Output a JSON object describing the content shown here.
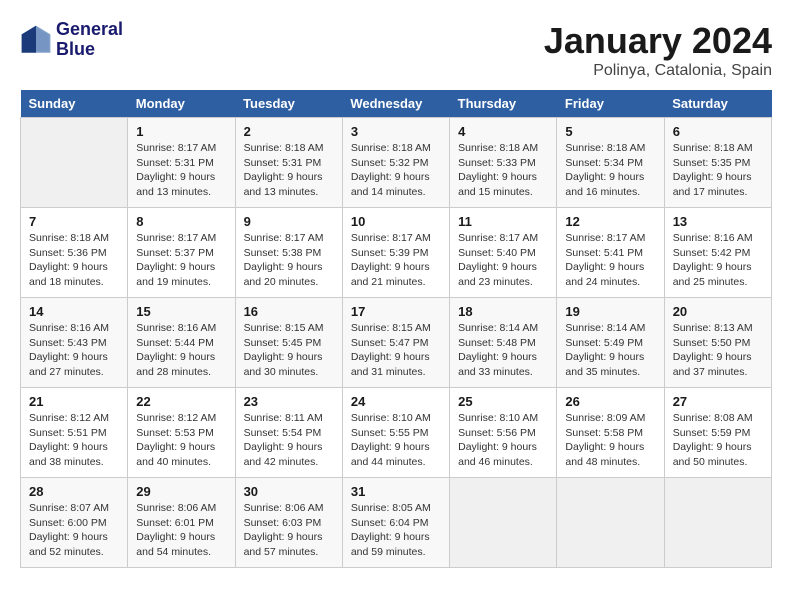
{
  "header": {
    "logo_line1": "General",
    "logo_line2": "Blue",
    "month": "January 2024",
    "location": "Polinya, Catalonia, Spain"
  },
  "weekdays": [
    "Sunday",
    "Monday",
    "Tuesday",
    "Wednesday",
    "Thursday",
    "Friday",
    "Saturday"
  ],
  "weeks": [
    [
      {
        "day": "",
        "sunrise": "",
        "sunset": "",
        "daylight": ""
      },
      {
        "day": "1",
        "sunrise": "Sunrise: 8:17 AM",
        "sunset": "Sunset: 5:31 PM",
        "daylight": "Daylight: 9 hours and 13 minutes."
      },
      {
        "day": "2",
        "sunrise": "Sunrise: 8:18 AM",
        "sunset": "Sunset: 5:31 PM",
        "daylight": "Daylight: 9 hours and 13 minutes."
      },
      {
        "day": "3",
        "sunrise": "Sunrise: 8:18 AM",
        "sunset": "Sunset: 5:32 PM",
        "daylight": "Daylight: 9 hours and 14 minutes."
      },
      {
        "day": "4",
        "sunrise": "Sunrise: 8:18 AM",
        "sunset": "Sunset: 5:33 PM",
        "daylight": "Daylight: 9 hours and 15 minutes."
      },
      {
        "day": "5",
        "sunrise": "Sunrise: 8:18 AM",
        "sunset": "Sunset: 5:34 PM",
        "daylight": "Daylight: 9 hours and 16 minutes."
      },
      {
        "day": "6",
        "sunrise": "Sunrise: 8:18 AM",
        "sunset": "Sunset: 5:35 PM",
        "daylight": "Daylight: 9 hours and 17 minutes."
      }
    ],
    [
      {
        "day": "7",
        "sunrise": "Sunrise: 8:18 AM",
        "sunset": "Sunset: 5:36 PM",
        "daylight": "Daylight: 9 hours and 18 minutes."
      },
      {
        "day": "8",
        "sunrise": "Sunrise: 8:17 AM",
        "sunset": "Sunset: 5:37 PM",
        "daylight": "Daylight: 9 hours and 19 minutes."
      },
      {
        "day": "9",
        "sunrise": "Sunrise: 8:17 AM",
        "sunset": "Sunset: 5:38 PM",
        "daylight": "Daylight: 9 hours and 20 minutes."
      },
      {
        "day": "10",
        "sunrise": "Sunrise: 8:17 AM",
        "sunset": "Sunset: 5:39 PM",
        "daylight": "Daylight: 9 hours and 21 minutes."
      },
      {
        "day": "11",
        "sunrise": "Sunrise: 8:17 AM",
        "sunset": "Sunset: 5:40 PM",
        "daylight": "Daylight: 9 hours and 23 minutes."
      },
      {
        "day": "12",
        "sunrise": "Sunrise: 8:17 AM",
        "sunset": "Sunset: 5:41 PM",
        "daylight": "Daylight: 9 hours and 24 minutes."
      },
      {
        "day": "13",
        "sunrise": "Sunrise: 8:16 AM",
        "sunset": "Sunset: 5:42 PM",
        "daylight": "Daylight: 9 hours and 25 minutes."
      }
    ],
    [
      {
        "day": "14",
        "sunrise": "Sunrise: 8:16 AM",
        "sunset": "Sunset: 5:43 PM",
        "daylight": "Daylight: 9 hours and 27 minutes."
      },
      {
        "day": "15",
        "sunrise": "Sunrise: 8:16 AM",
        "sunset": "Sunset: 5:44 PM",
        "daylight": "Daylight: 9 hours and 28 minutes."
      },
      {
        "day": "16",
        "sunrise": "Sunrise: 8:15 AM",
        "sunset": "Sunset: 5:45 PM",
        "daylight": "Daylight: 9 hours and 30 minutes."
      },
      {
        "day": "17",
        "sunrise": "Sunrise: 8:15 AM",
        "sunset": "Sunset: 5:47 PM",
        "daylight": "Daylight: 9 hours and 31 minutes."
      },
      {
        "day": "18",
        "sunrise": "Sunrise: 8:14 AM",
        "sunset": "Sunset: 5:48 PM",
        "daylight": "Daylight: 9 hours and 33 minutes."
      },
      {
        "day": "19",
        "sunrise": "Sunrise: 8:14 AM",
        "sunset": "Sunset: 5:49 PM",
        "daylight": "Daylight: 9 hours and 35 minutes."
      },
      {
        "day": "20",
        "sunrise": "Sunrise: 8:13 AM",
        "sunset": "Sunset: 5:50 PM",
        "daylight": "Daylight: 9 hours and 37 minutes."
      }
    ],
    [
      {
        "day": "21",
        "sunrise": "Sunrise: 8:12 AM",
        "sunset": "Sunset: 5:51 PM",
        "daylight": "Daylight: 9 hours and 38 minutes."
      },
      {
        "day": "22",
        "sunrise": "Sunrise: 8:12 AM",
        "sunset": "Sunset: 5:53 PM",
        "daylight": "Daylight: 9 hours and 40 minutes."
      },
      {
        "day": "23",
        "sunrise": "Sunrise: 8:11 AM",
        "sunset": "Sunset: 5:54 PM",
        "daylight": "Daylight: 9 hours and 42 minutes."
      },
      {
        "day": "24",
        "sunrise": "Sunrise: 8:10 AM",
        "sunset": "Sunset: 5:55 PM",
        "daylight": "Daylight: 9 hours and 44 minutes."
      },
      {
        "day": "25",
        "sunrise": "Sunrise: 8:10 AM",
        "sunset": "Sunset: 5:56 PM",
        "daylight": "Daylight: 9 hours and 46 minutes."
      },
      {
        "day": "26",
        "sunrise": "Sunrise: 8:09 AM",
        "sunset": "Sunset: 5:58 PM",
        "daylight": "Daylight: 9 hours and 48 minutes."
      },
      {
        "day": "27",
        "sunrise": "Sunrise: 8:08 AM",
        "sunset": "Sunset: 5:59 PM",
        "daylight": "Daylight: 9 hours and 50 minutes."
      }
    ],
    [
      {
        "day": "28",
        "sunrise": "Sunrise: 8:07 AM",
        "sunset": "Sunset: 6:00 PM",
        "daylight": "Daylight: 9 hours and 52 minutes."
      },
      {
        "day": "29",
        "sunrise": "Sunrise: 8:06 AM",
        "sunset": "Sunset: 6:01 PM",
        "daylight": "Daylight: 9 hours and 54 minutes."
      },
      {
        "day": "30",
        "sunrise": "Sunrise: 8:06 AM",
        "sunset": "Sunset: 6:03 PM",
        "daylight": "Daylight: 9 hours and 57 minutes."
      },
      {
        "day": "31",
        "sunrise": "Sunrise: 8:05 AM",
        "sunset": "Sunset: 6:04 PM",
        "daylight": "Daylight: 9 hours and 59 minutes."
      },
      {
        "day": "",
        "sunrise": "",
        "sunset": "",
        "daylight": ""
      },
      {
        "day": "",
        "sunrise": "",
        "sunset": "",
        "daylight": ""
      },
      {
        "day": "",
        "sunrise": "",
        "sunset": "",
        "daylight": ""
      }
    ]
  ]
}
